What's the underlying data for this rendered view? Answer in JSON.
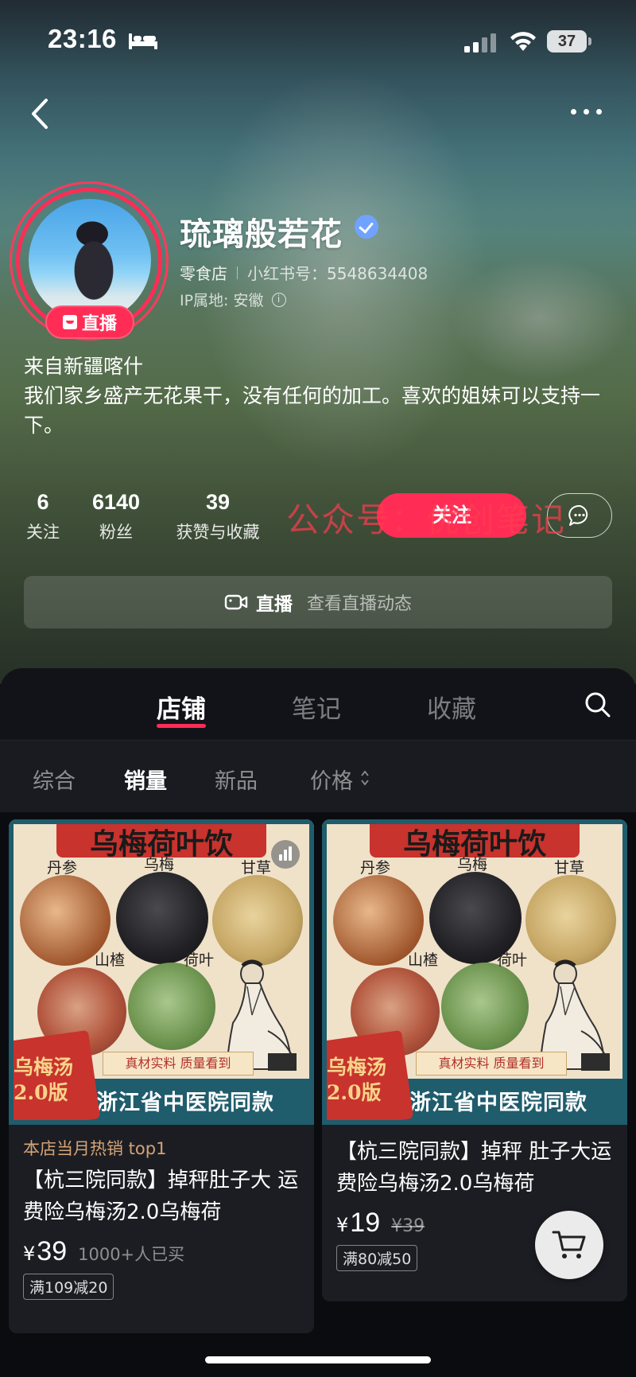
{
  "status_bar": {
    "time": "23:16",
    "battery": "37"
  },
  "profile": {
    "name": "琉璃般若花",
    "category": "零食店",
    "xhs_id": "小红书号：5548634408",
    "ip_location": "IP属地: 安徽",
    "live_badge": "直播",
    "bio_line1": "来自新疆喀什",
    "bio_line2": "我们家乡盛产无花果干，没有任何的加工。喜欢的姐妹可以支持一下。"
  },
  "stats": [
    {
      "value": "6",
      "label": "关注"
    },
    {
      "value": "6140",
      "label": "粉丝"
    },
    {
      "value": "39",
      "label": "获赞与收藏"
    }
  ],
  "actions": {
    "follow": "关注",
    "watermark": "公众号：优创笔记"
  },
  "live_bar": {
    "title": "直播",
    "subtitle": "查看直播动态"
  },
  "tabs": [
    "店铺",
    "笔记",
    "收藏"
  ],
  "filters": [
    "综合",
    "销量",
    "新品",
    "价格"
  ],
  "products": [
    {
      "image": {
        "title": "乌梅荷叶饮",
        "herbs": [
          "丹参",
          "乌梅",
          "甘草",
          "山楂",
          "荷叶"
        ],
        "quality": "真材实料 质量看到",
        "badge": "乌梅汤2.0版",
        "bottom": "浙江省中医院同款"
      },
      "tag": "本店当月热销 top1",
      "title": "【杭三院同款】掉秤肚子大 运费险乌梅汤2.0乌梅荷",
      "currency": "¥",
      "price": "39",
      "sold": "1000+人已买",
      "coupon": "满109减20"
    },
    {
      "image": {
        "title": "乌梅荷叶饮",
        "herbs": [
          "丹参",
          "乌梅",
          "甘草",
          "山楂",
          "荷叶"
        ],
        "quality": "真材实料 质量看到",
        "badge": "乌梅汤2.0版",
        "bottom": "浙江省中医院同款"
      },
      "title": "【杭三院同款】掉秤 肚子大运费险乌梅汤2.0乌梅荷",
      "currency": "¥",
      "price": "19",
      "original_price": "¥39",
      "coupon": "满80减50"
    }
  ],
  "colors": {
    "accent": "#ff2d55",
    "tag": "#d4a374",
    "panel": "#121318"
  }
}
